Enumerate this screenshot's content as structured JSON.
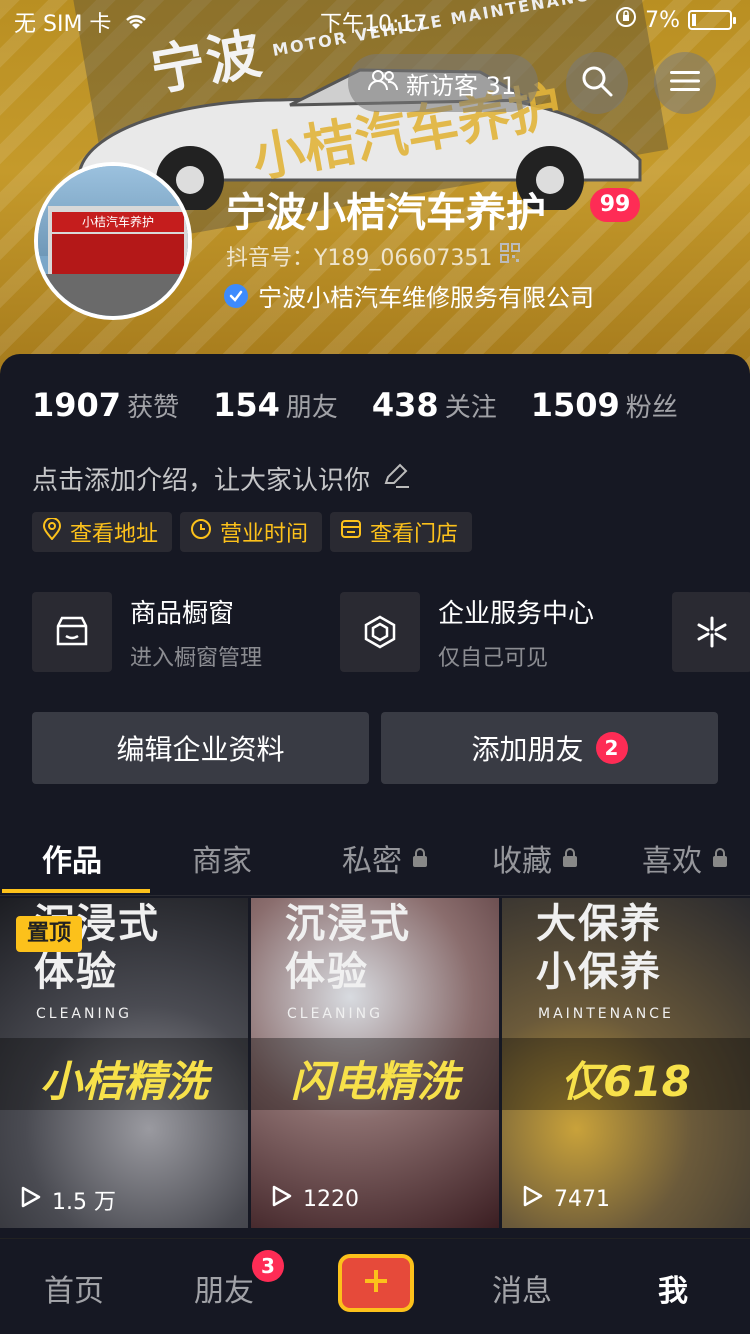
{
  "status_bar": {
    "carrier": "无 SIM 卡",
    "time": "下午10:17",
    "battery": "7%"
  },
  "banner": {
    "text_a": "宁波",
    "text_b": "MOTOR VEHICLE MAINTENANCE",
    "text_c": "小桔汽车养护"
  },
  "header": {
    "visitors_label": "新访客 31"
  },
  "profile": {
    "name": "宁波小桔汽车养护",
    "name_badge": "99",
    "douyin_id": "抖音号：Y189_06607351",
    "company": "宁波小桔汽车维修服务有限公司",
    "avatar_sign": "小桔汽车养护"
  },
  "stats": [
    {
      "num": "1907",
      "label": "获赞"
    },
    {
      "num": "154",
      "label": "朋友"
    },
    {
      "num": "438",
      "label": "关注"
    },
    {
      "num": "1509",
      "label": "粉丝"
    }
  ],
  "intro": "点击添加介绍，让大家认识你",
  "tags": [
    {
      "label": "查看地址",
      "icon": "location-icon"
    },
    {
      "label": "营业时间",
      "icon": "clock-icon"
    },
    {
      "label": "查看门店",
      "icon": "store-icon"
    }
  ],
  "services": [
    {
      "title": "商品橱窗",
      "sub": "进入橱窗管理",
      "icon": "shop-icon"
    },
    {
      "title": "企业服务中心",
      "sub": "仅自己可见",
      "icon": "cube-icon"
    }
  ],
  "buttons": {
    "edit": "编辑企业资料",
    "add_friend": "添加朋友",
    "add_friend_badge": "2"
  },
  "tabs": [
    {
      "label": "作品",
      "locked": false
    },
    {
      "label": "商家",
      "locked": false
    },
    {
      "label": "私密",
      "locked": true
    },
    {
      "label": "收藏",
      "locked": true
    },
    {
      "label": "喜欢",
      "locked": true
    }
  ],
  "videos": [
    {
      "h1": "沉浸式\n体验",
      "h2": "CLEANING",
      "label": "小桔精洗",
      "count": "1.5 万",
      "pinned": "置顶"
    },
    {
      "h1": "沉浸式\n体验",
      "h2": "CLEANING",
      "label": "闪电精洗",
      "count": "1220"
    },
    {
      "h1": "大保养\n小保养",
      "h2": "MAINTENANCE",
      "label": "仅618",
      "count": "7471"
    }
  ],
  "bottom_nav": {
    "home": "首页",
    "friends": "朋友",
    "friends_badge": "3",
    "messages": "消息",
    "me": "我"
  },
  "colors": {
    "accent": "#fcc11b",
    "badge": "#fe2c55",
    "background": "#161823",
    "banner": "#c59a2b"
  }
}
